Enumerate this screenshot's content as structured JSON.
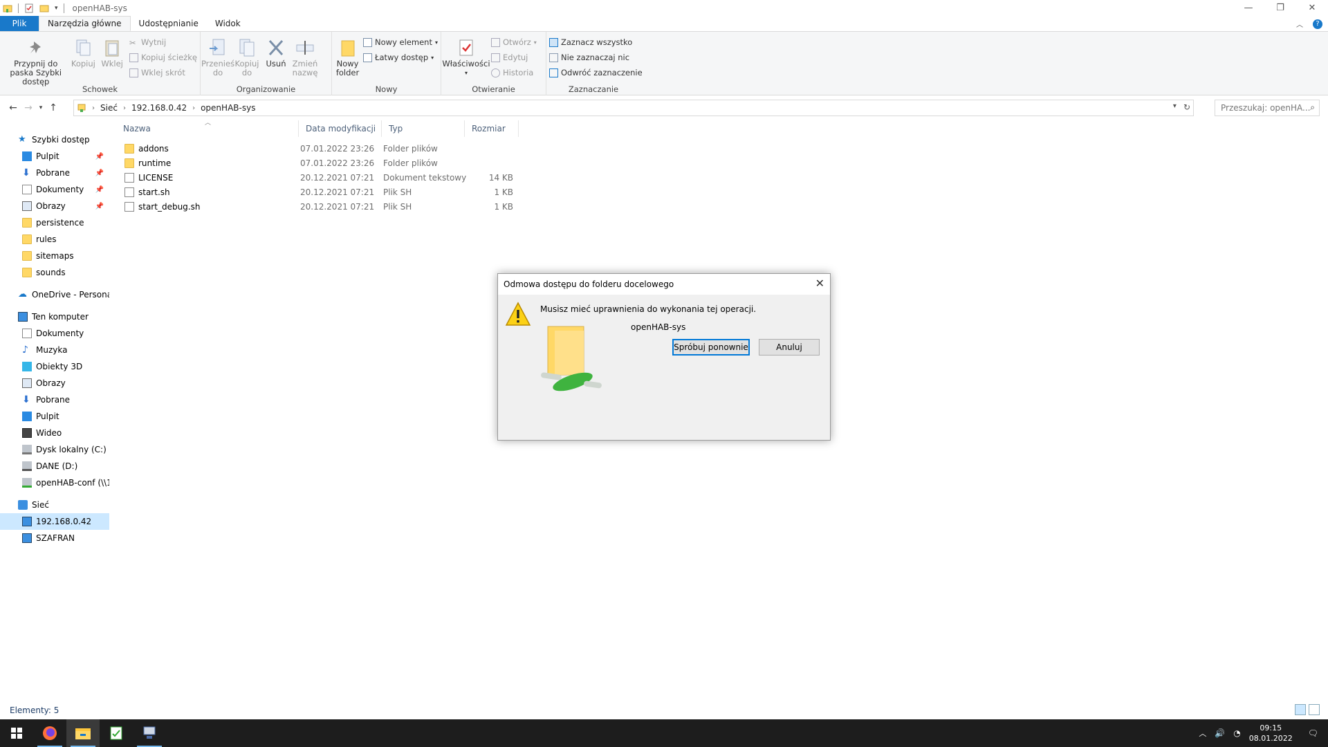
{
  "window": {
    "title": "openHAB-sys"
  },
  "ribbon_tabs": [
    "Plik",
    "Narzędzia główne",
    "Udostępnianie",
    "Widok"
  ],
  "ribbon": {
    "schowek": {
      "label": "Schowek",
      "pin": "Przypnij do paska Szybki dostęp",
      "copy": "Kopiuj",
      "paste": "Wklej",
      "cut": "Wytnij",
      "copy_path": "Kopiuj ścieżkę",
      "paste_shortcut": "Wklej skrót"
    },
    "organizowanie": {
      "label": "Organizowanie",
      "move_to": "Przenieś do",
      "copy_to": "Kopiuj do",
      "delete": "Usuń",
      "rename": "Zmień nazwę"
    },
    "nowy": {
      "label": "Nowy",
      "new_folder": "Nowy folder",
      "new_item": "Nowy element",
      "easy_access": "Łatwy dostęp"
    },
    "otwieranie": {
      "label": "Otwieranie",
      "properties": "Właściwości",
      "open": "Otwórz",
      "edit": "Edytuj",
      "history": "Historia"
    },
    "zaznaczanie": {
      "label": "Zaznaczanie",
      "select_all": "Zaznacz wszystko",
      "select_none": "Nie zaznaczaj nic",
      "invert": "Odwróć zaznaczenie"
    }
  },
  "address": {
    "crumbs": [
      "Sieć",
      "192.168.0.42",
      "openHAB-sys"
    ],
    "search_placeholder": "Przeszukaj: openHA..."
  },
  "sidebar": {
    "quick_access": "Szybki dostęp",
    "quick_items": [
      "Pulpit",
      "Pobrane",
      "Dokumenty",
      "Obrazy",
      "persistence",
      "rules",
      "sitemaps",
      "sounds"
    ],
    "onedrive": "OneDrive - Personal",
    "this_pc": "Ten komputer",
    "pc_items": [
      "Dokumenty",
      "Muzyka",
      "Obiekty 3D",
      "Obrazy",
      "Pobrane",
      "Pulpit",
      "Wideo",
      "Dysk lokalny (C:)",
      "DANE (D:)",
      "openHAB-conf (\\\\1"
    ],
    "network": "Sieć",
    "net_items": [
      "192.168.0.42",
      "SZAFRAN"
    ]
  },
  "columns": {
    "name": "Nazwa",
    "date": "Data modyfikacji",
    "type": "Typ",
    "size": "Rozmiar"
  },
  "files": [
    {
      "name": "addons",
      "date": "07.01.2022 23:26",
      "type": "Folder plików",
      "size": ""
    },
    {
      "name": "runtime",
      "date": "07.01.2022 23:26",
      "type": "Folder plików",
      "size": ""
    },
    {
      "name": "LICENSE",
      "date": "20.12.2021 07:21",
      "type": "Dokument tekstowy",
      "size": "14 KB"
    },
    {
      "name": "start.sh",
      "date": "20.12.2021 07:21",
      "type": "Plik SH",
      "size": "1 KB"
    },
    {
      "name": "start_debug.sh",
      "date": "20.12.2021 07:21",
      "type": "Plik SH",
      "size": "1 KB"
    }
  ],
  "status": {
    "items": "Elementy: 5"
  },
  "dialog": {
    "title": "Odmowa dostępu do folderu docelowego",
    "message": "Musisz mieć uprawnienia do wykonania tej operacji.",
    "folder_name": "openHAB-sys",
    "retry": "Spróbuj ponownie",
    "cancel": "Anuluj"
  },
  "taskbar": {
    "time": "09:15",
    "date": "08.01.2022"
  },
  "colors": {
    "accent": "#1979ca",
    "selection": "#cce8ff",
    "taskbar": "#1d1d1d",
    "folder": "#ffd866"
  }
}
